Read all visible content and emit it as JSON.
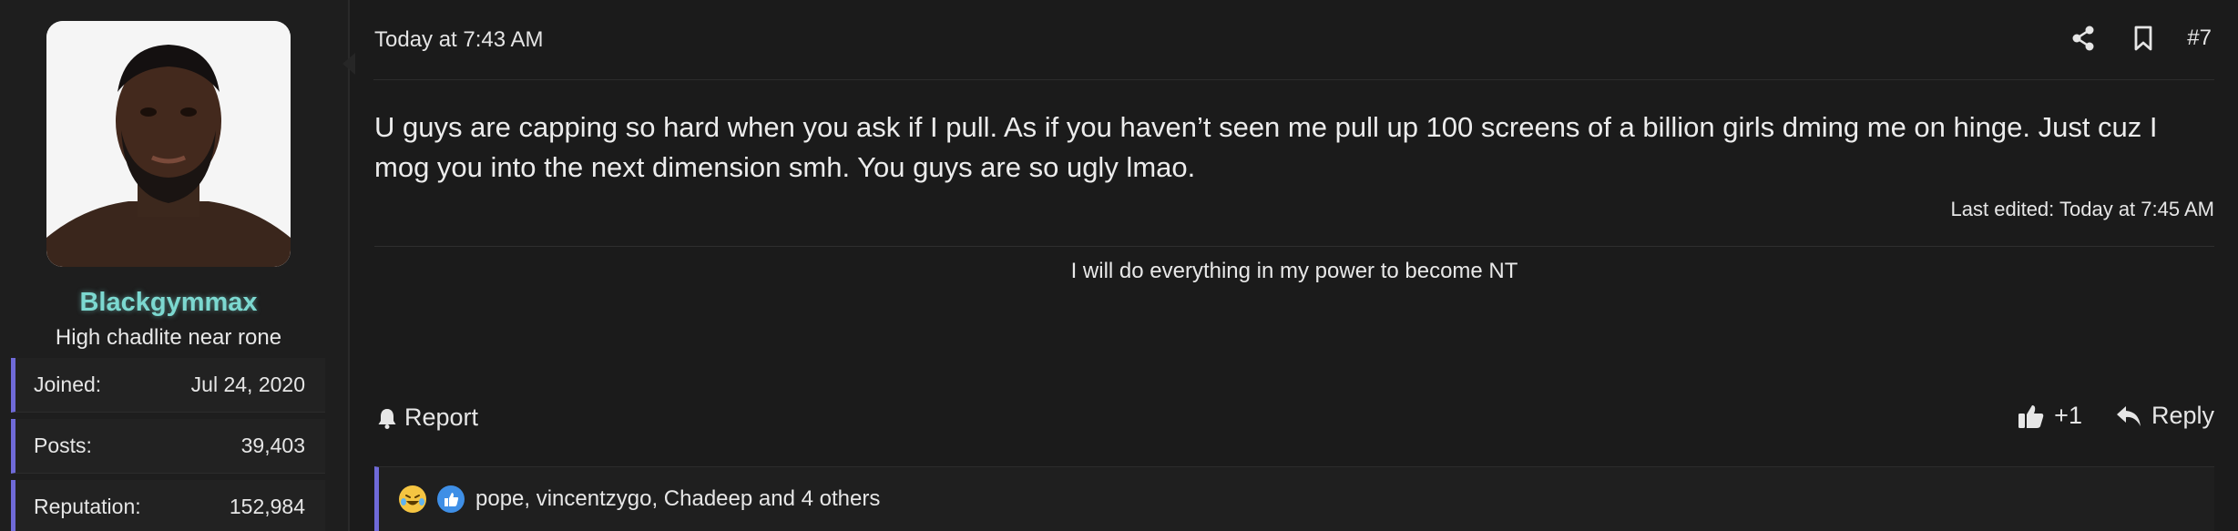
{
  "user": {
    "username": "Blackgymmax",
    "title": "High chadlite near rone",
    "stats": [
      {
        "label": "Joined:",
        "value": "Jul 24, 2020"
      },
      {
        "label": "Posts:",
        "value": "39,403"
      },
      {
        "label": "Reputation:",
        "value": "152,984"
      }
    ]
  },
  "message": {
    "timestamp": "Today at 7:43 AM",
    "post_number": "#7",
    "body": "U guys are capping so hard when you ask if I pull. As if you haven’t seen me pull up 100 screens of a billion girls dming me on hinge. Just cuz I mog you into the next dimension smh. You guys are so ugly lmao.",
    "last_edited": "Last edited: Today at 7:45 AM",
    "signature": "I will do everything in my power to become NT"
  },
  "footer": {
    "report_label": "Report",
    "like_count": "+1",
    "reply_label": "Reply"
  },
  "reactions": {
    "text": "pope, vincentzygo, Chadeep and 4 others"
  },
  "icons": {
    "share": "share-icon",
    "bookmark": "bookmark-icon",
    "bell": "bell-icon",
    "like": "thumbs-up-icon",
    "reply": "reply-arrow-icon",
    "laugh": "laughing-crying-icon",
    "like_reaction": "like-reaction-icon"
  },
  "colors": {
    "background": "#1b1b1b",
    "username": "#7cd8d0",
    "accent_border": "#6f6ad8"
  }
}
